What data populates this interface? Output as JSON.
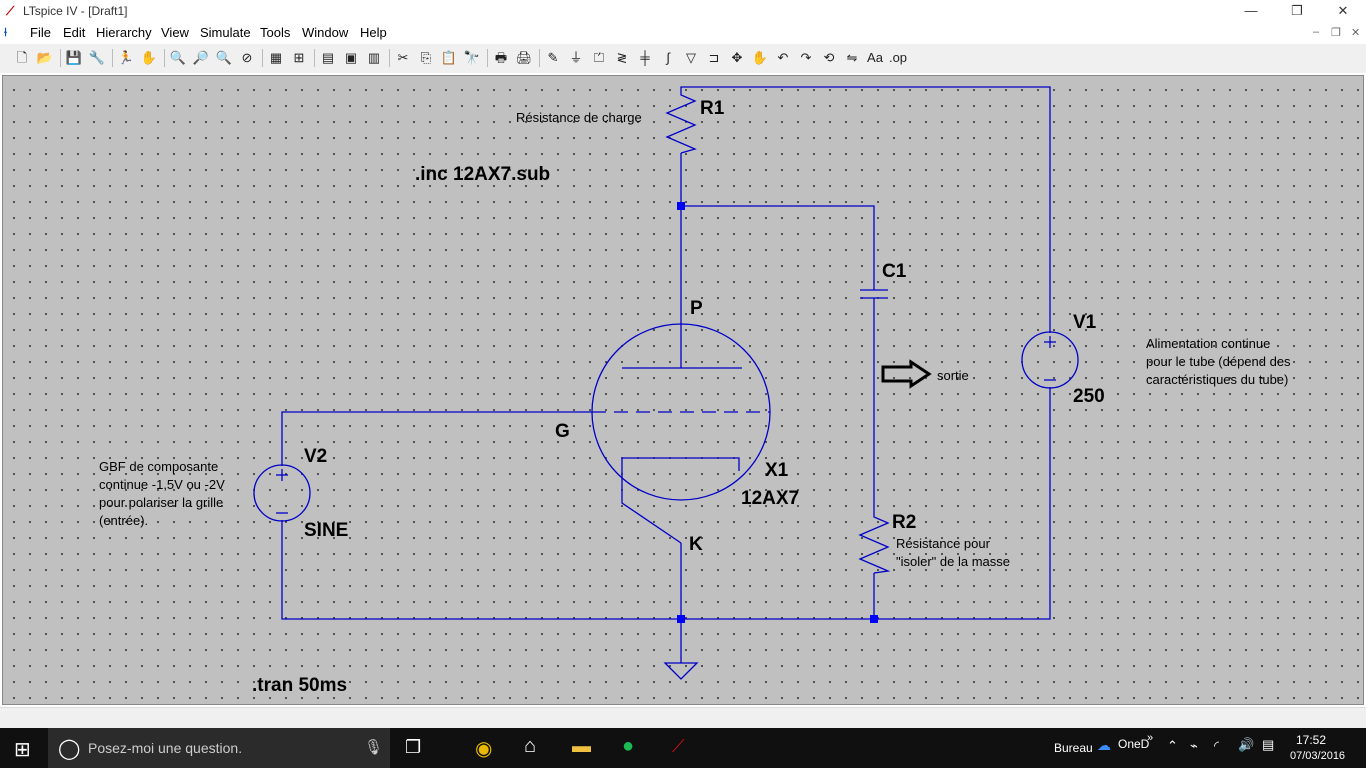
{
  "window": {
    "title": "LTspice IV - [Draft1]",
    "minimize": "—",
    "restore": "❐",
    "close": "✕"
  },
  "menu": {
    "items": [
      "File",
      "Edit",
      "Hierarchy",
      "View",
      "Simulate",
      "Tools",
      "Window",
      "Help"
    ],
    "mdi": {
      "min": "–",
      "restore": "❐",
      "close": "✕"
    }
  },
  "toolbar": {
    "buttons": [
      {
        "icon": "new-schematic-icon",
        "glyph": "🗋"
      },
      {
        "icon": "open-icon",
        "glyph": "📂"
      },
      {
        "icon": "save-icon",
        "glyph": "💾"
      },
      {
        "icon": "control-panel-icon",
        "glyph": "🔧"
      },
      {
        "icon": "run-icon",
        "glyph": "🏃"
      },
      {
        "icon": "halt-icon",
        "glyph": "✋"
      },
      {
        "icon": "zoom-in-icon",
        "glyph": "🔍"
      },
      {
        "icon": "pan-icon",
        "glyph": "🔎"
      },
      {
        "icon": "zoom-out-icon",
        "glyph": "🔍"
      },
      {
        "icon": "zoom-fit-icon",
        "glyph": "⊘"
      },
      {
        "icon": "autorange-icon",
        "glyph": "▦"
      },
      {
        "icon": "grid-icon",
        "glyph": "⊞"
      },
      {
        "icon": "tile-horizontal-icon",
        "glyph": "▤"
      },
      {
        "icon": "cascade-icon",
        "glyph": "▣"
      },
      {
        "icon": "tile-vertical-icon",
        "glyph": "▥"
      },
      {
        "icon": "cut-icon",
        "glyph": "✂"
      },
      {
        "icon": "copy-icon",
        "glyph": "⎘"
      },
      {
        "icon": "paste-icon",
        "glyph": "📋"
      },
      {
        "icon": "find-icon",
        "glyph": "🔭"
      },
      {
        "icon": "print-preview-icon",
        "glyph": "🖶"
      },
      {
        "icon": "print-icon",
        "glyph": "🖨"
      },
      {
        "icon": "draw-wire-icon",
        "glyph": "✎"
      },
      {
        "icon": "ground-icon",
        "glyph": "⏚"
      },
      {
        "icon": "label-net-icon",
        "glyph": "⏍"
      },
      {
        "icon": "resistor-icon",
        "glyph": "≷"
      },
      {
        "icon": "capacitor-icon",
        "glyph": "╪"
      },
      {
        "icon": "inductor-icon",
        "glyph": "∫"
      },
      {
        "icon": "diode-icon",
        "glyph": "▽"
      },
      {
        "icon": "component-icon",
        "glyph": "⊐"
      },
      {
        "icon": "move-icon",
        "glyph": "✥"
      },
      {
        "icon": "drag-icon",
        "glyph": "✋"
      },
      {
        "icon": "undo-icon",
        "glyph": "↶"
      },
      {
        "icon": "redo-icon",
        "glyph": "↷"
      },
      {
        "icon": "rotate-icon",
        "glyph": "⟲"
      },
      {
        "icon": "mirror-icon",
        "glyph": "⇋"
      },
      {
        "icon": "text-icon",
        "glyph": "Aa"
      },
      {
        "icon": "spice-directive-icon",
        "glyph": ".op"
      }
    ]
  },
  "schematic": {
    "labels": {
      "r1": "R1",
      "r1_comment": "Résistance de charge",
      "inc": ".inc 12AX7.sub",
      "c1": "C1",
      "p": "P",
      "g": "G",
      "k": "K",
      "x1": "X1",
      "x1_value": "12AX7",
      "v1": "V1",
      "v1_value": "250",
      "v2": "V2",
      "v2_value": "SINE",
      "r2": "R2",
      "sortie": "sortie",
      "tran": ".tran 50ms",
      "v1_comment": [
        "Alimentation continue",
        "pour le tube (dépend des",
        "caractéristiques du tube)"
      ],
      "v2_comment": [
        "GBF de composante",
        "continue -1,5V ou -2V",
        "pour polariser la grille",
        "(entrée)."
      ],
      "r2_comment": [
        "Résistance pour",
        "\"isoler\" de la masse"
      ]
    },
    "colors": {
      "wire": "#0000c8",
      "background": "#c0c0c0",
      "junction": "#0000ff"
    }
  },
  "taskbar": {
    "search_placeholder": "Posez-moi une question.",
    "tray": {
      "desktop": "Bureau",
      "onedrive": "OneD",
      "time": "17:52",
      "date": "07/03/2016"
    }
  }
}
